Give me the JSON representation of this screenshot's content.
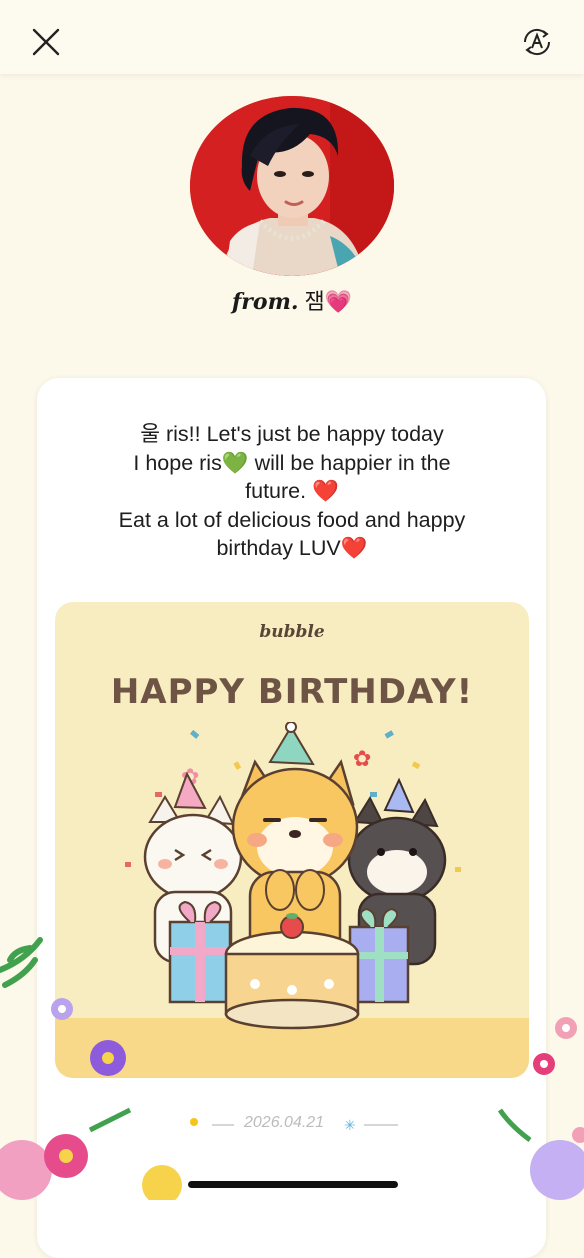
{
  "sender": {
    "from_label": "from.",
    "name": "잼💗"
  },
  "message": {
    "lines": [
      "울 ris!! Let's just be happy today",
      "I hope ris💚 will be happier in the",
      "future. ❤️",
      "Eat a lot of delicious food and happy",
      "birthday LUV❤️"
    ]
  },
  "birthday_card": {
    "logo": "bubble",
    "title": "HAPPY BIRTHDAY!"
  },
  "footer": {
    "date": "2026.04.21"
  },
  "icons": {
    "close": "close-icon",
    "translate": "translate-icon"
  },
  "colors": {
    "background": "#fcf8ea",
    "card_bg": "#f8edc1",
    "title_color": "#6e5444"
  }
}
